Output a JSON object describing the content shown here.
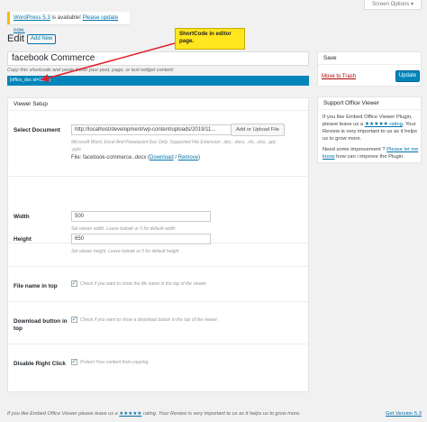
{
  "screen_options": "Screen Options ▾",
  "notice": {
    "version_text": "WordPress 5.3",
    "available_text": " is available! ",
    "update_link": "Please update now."
  },
  "page": {
    "title": "Edit",
    "add_new": "Add New",
    "post_title": "facebook Commerce",
    "shortcode_note": "Copy this shortcode and paste it into your post, page, or text widget content:",
    "shortcode": "[office_doc id=1275]"
  },
  "callout": {
    "text": "ShortCode in editor page."
  },
  "viewer_setup": {
    "heading": "Viewer Setup",
    "select_document": {
      "label": "Select Document",
      "value": "http://localhost/development/wp-content/uploads/2019/11...",
      "button": "Add or Upload File",
      "desc": "Microsoft Word, Excel And Powerpoint Doc Only. Supported File Extension: .doc, .docx, .xls, .xlsx, .ppt, .pptx",
      "file_prefix": "File: facebook-commerce..docx (",
      "download": "Download",
      "sep": " / ",
      "remove": "Remove",
      "file_suffix": ")"
    },
    "width": {
      "label": "Width",
      "value": "500",
      "desc": "Set viewer width. Leave balnak or 0 for default width"
    },
    "height": {
      "label": "Height",
      "value": "650",
      "desc": "Set viewer height. Leave balnak or 0 for default height"
    },
    "file_name_top": {
      "label": "File name in top",
      "checked": true,
      "desc": "Check if you want to show the file name in the top of the viewer."
    },
    "download_top": {
      "label1": "Download button in",
      "label2": "top",
      "checked": true,
      "desc": "Check if you want to show a download button in the top of the viewer."
    },
    "disable_right_click": {
      "label": "Disable Right Click",
      "checked": true,
      "desc": "Protect Your content from copying."
    }
  },
  "save_box": {
    "heading": "Save",
    "trash": "Move to Trash",
    "update": "Update"
  },
  "support_box": {
    "heading": "Support Office Viewer",
    "line1_prefix": "If you like Embed Office Viewer Plugin, please leave us a ",
    "rating_link": "★★★★★ rating",
    "line1_suffix": ". Your Review is very important to us as it helps us to grow more.",
    "line2_prefix": "Need some improvement ? ",
    "let_me_know": "Please let me know",
    "line2_suffix": " how can i improve the Plugin."
  },
  "footer": {
    "left_prefix": "If you like Embed Office Viewer please leave us a ",
    "left_link": "★★★★★",
    "left_suffix": " rating. Your Review is very important to us as it helps us to grow more.",
    "version": "Get Version 5.3"
  },
  "colors": {
    "accent": "#0085ba",
    "link": "#0073aa",
    "callout": "#ffe61e",
    "arrow": "#e0202a"
  }
}
